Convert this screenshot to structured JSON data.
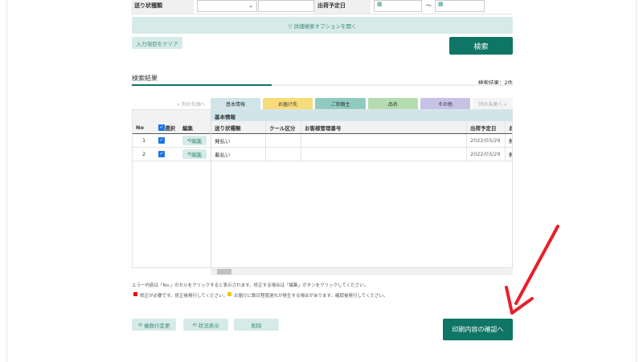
{
  "search": {
    "status_label": "送り状種類",
    "date_label": "出荷予定日",
    "tilde": "～",
    "status_value": "",
    "advanced_label": "▽ 詳細検索オプションを開く",
    "clear_label": "入力項目をクリア",
    "search_label": "検索"
  },
  "results": {
    "title": "検索結果",
    "count": "検索結果：2件"
  },
  "tabs": {
    "prev": "« 列の先頭へ",
    "next": "列の末尾へ »",
    "items": [
      {
        "label": "基本情報",
        "color": "#cfe5ea"
      },
      {
        "label": "お届け先",
        "color": "#f6dc7a"
      },
      {
        "label": "ご依頼主",
        "color": "#8fcbc0"
      },
      {
        "label": "品名",
        "color": "#b5dcb0"
      },
      {
        "label": "その他",
        "color": "#c7c3e6"
      }
    ]
  },
  "table": {
    "group_header": "基本情報",
    "headers": {
      "no": "No",
      "select": "選択",
      "edit": "編集",
      "status": "送り状種類",
      "cool": "クール区分",
      "customer_no": "お客様管理番号",
      "ship_date": "出荷予定日",
      "next": "お"
    },
    "rows": [
      {
        "no": "1",
        "edit": "編集",
        "status": "発払い",
        "cool": "",
        "customer_no": "",
        "ship_date": "2022/03/29",
        "next": "郵"
      },
      {
        "no": "2",
        "edit": "編集",
        "status": "着払い",
        "cool": "",
        "customer_no": "",
        "ship_date": "2022/03/29",
        "next": "郵"
      }
    ]
  },
  "notes": {
    "line1": "エラー内容は「No.」のセルをクリックすると表示されます。修正する場合は「編集」ボタンをクリックしてください。",
    "red": "修正が必要です。修正後発行してください。",
    "yellow": "お届けに数日程度遅れが発生する場合があります。確認後発行してください。"
  },
  "footer": {
    "multi_edit": "複数行変更",
    "status_view": "状況表示",
    "delete": "削除",
    "confirm": "印刷内容の確認へ"
  }
}
